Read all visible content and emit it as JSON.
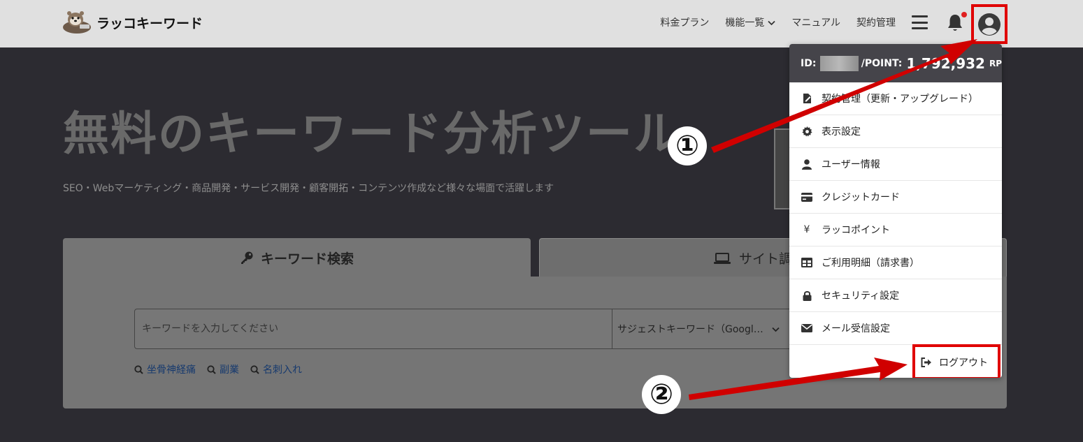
{
  "header": {
    "logo_text": "ラッコキーワード",
    "nav": {
      "pricing": "料金プラン",
      "features": "機能一覧",
      "manual": "マニュアル",
      "contract": "契約管理"
    }
  },
  "hero": {
    "title": "無料のキーワード分析ツール",
    "subtitle": "SEO・Webマーケティング・商品開発・サービス開発・顧客開拓・コンテンツ作成など様々な場面で活躍します"
  },
  "tabs": {
    "keyword": "キーワード検索",
    "site": "サイト調査（競"
  },
  "search": {
    "placeholder": "キーワードを入力してください",
    "select_value": "サジェストキーワード（Googl…"
  },
  "suggests": [
    "坐骨神経痛",
    "副業",
    "名刺入れ"
  ],
  "dropdown": {
    "id_label": "ID:",
    "point_label": "/POINT:",
    "point_value": "1,792,932",
    "point_unit": "RP",
    "items": [
      {
        "label": "契約管理（更新・アップグレード）",
        "icon": "contract-icon"
      },
      {
        "label": "表示設定",
        "icon": "gear-icon"
      },
      {
        "label": "ユーザー情報",
        "icon": "user-icon"
      },
      {
        "label": "クレジットカード",
        "icon": "credit-card-icon"
      },
      {
        "label": "ラッコポイント",
        "icon": "yen-icon"
      },
      {
        "label": "ご利用明細（請求書）",
        "icon": "table-icon"
      },
      {
        "label": "セキュリティ設定",
        "icon": "lock-icon"
      },
      {
        "label": "メール受信設定",
        "icon": "envelope-icon"
      }
    ],
    "logout": "ログアウト"
  },
  "annotations": {
    "step1": "①",
    "step2": "②"
  },
  "colors": {
    "highlight": "#e00000",
    "header_bg": "#e0e0e0",
    "page_bg": "#2c2b31",
    "dropdown_head": "#45444a",
    "link": "#173a6e"
  }
}
